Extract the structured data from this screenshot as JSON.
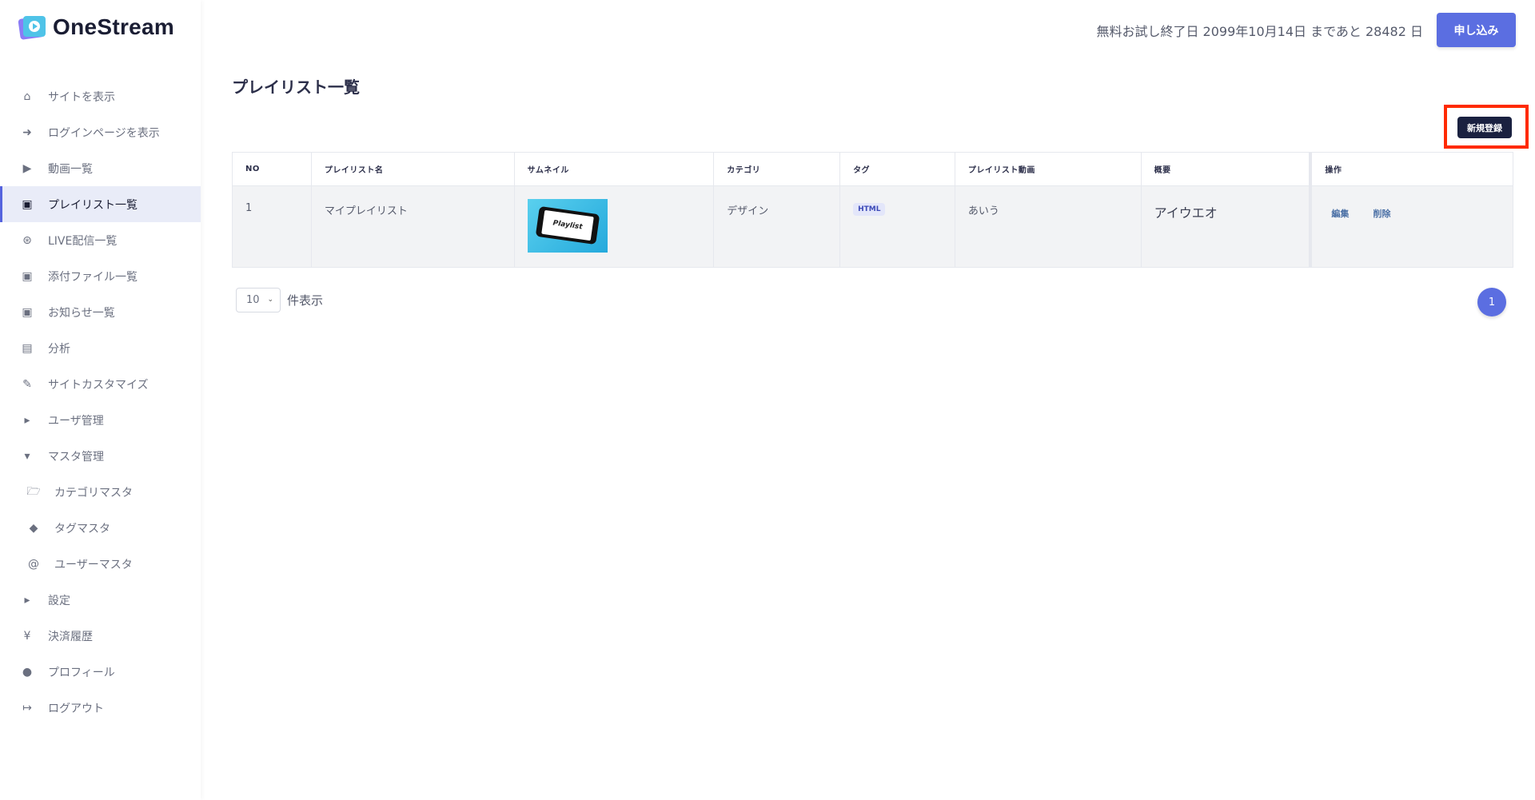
{
  "brand": {
    "name": "OneStream"
  },
  "header": {
    "trial_text": "無料お試し終了日 2099年10月14日 まであと 28482 日",
    "apply_label": "申し込み"
  },
  "sidebar": {
    "items": [
      {
        "label": "サイトを表示",
        "icon": "home-icon"
      },
      {
        "label": "ログインページを表示",
        "icon": "sign-in-icon"
      },
      {
        "label": "動画一覧",
        "icon": "video-icon"
      },
      {
        "label": "プレイリスト一覧",
        "icon": "images-icon",
        "active": true
      },
      {
        "label": "LIVE配信一覧",
        "icon": "broadcast-icon"
      },
      {
        "label": "添付ファイル一覧",
        "icon": "images-icon"
      },
      {
        "label": "お知らせ一覧",
        "icon": "images-icon"
      },
      {
        "label": "分析",
        "icon": "chart-icon"
      },
      {
        "label": "サイトカスタマイズ",
        "icon": "edit-icon"
      },
      {
        "label": "ユーザ管理",
        "icon": "caret-right-icon"
      },
      {
        "label": "マスタ管理",
        "icon": "caret-down-icon"
      },
      {
        "label": "カテゴリマスタ",
        "icon": "folder-icon"
      },
      {
        "label": "タグマスタ",
        "icon": "tags-icon"
      },
      {
        "label": "ユーザーマスタ",
        "icon": "at-icon"
      },
      {
        "label": "設定",
        "icon": "caret-right-icon"
      },
      {
        "label": "決済履歴",
        "icon": "yen-icon"
      },
      {
        "label": "プロフィール",
        "icon": "user-circle-icon"
      },
      {
        "label": "ログアウト",
        "icon": "sign-out-icon"
      }
    ]
  },
  "main": {
    "title": "プレイリスト一覧",
    "new_button_label": "新規登録",
    "table": {
      "headers": [
        "NO",
        "プレイリスト名",
        "サムネイル",
        "カテゴリ",
        "タグ",
        "プレイリスト動画",
        "概要",
        "操作"
      ],
      "rows": [
        {
          "no": "1",
          "name": "マイプレイリスト",
          "thumbnail_text": "Playlist",
          "category": "デザイン",
          "tag": "HTML",
          "videos": "あいう",
          "summary": "アイウエオ",
          "edit_label": "編集",
          "delete_label": "削除"
        }
      ]
    },
    "pagination": {
      "per_page_value": "10",
      "per_page_label": "件表示",
      "current_page": "1"
    }
  },
  "colors": {
    "accent": "#5b6ee1",
    "highlight_border": "#ff2a00",
    "dark_button": "#1a2140"
  }
}
